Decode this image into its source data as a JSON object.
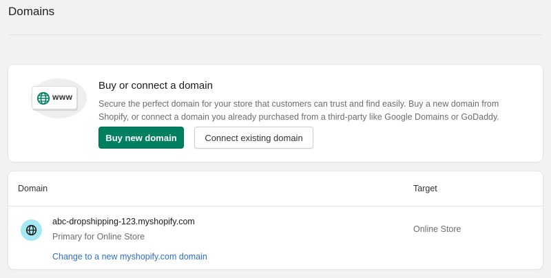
{
  "page": {
    "title": "Domains"
  },
  "buy_card": {
    "illustration_text": "www",
    "title": "Buy or connect a domain",
    "description": "Secure the perfect domain for your store that customers can trust and find easily. Buy a new domain from Shopify, or connect a domain you already purchased from a third-party like Google Domains or GoDaddy.",
    "buy_button": "Buy new domain",
    "connect_button": "Connect existing domain"
  },
  "domains_table": {
    "headers": {
      "domain": "Domain",
      "target": "Target"
    },
    "rows": [
      {
        "icon": "globe-icon",
        "domain": "abc-dropshipping-123.myshopify.com",
        "subtitle": "Primary for Online Store",
        "link": "Change to a new myshopify.com domain",
        "target": "Online Store"
      }
    ]
  },
  "colors": {
    "primary": "#008060",
    "link": "#2c6ecb",
    "globe_bg": "#a4e8f2",
    "illustration_globe": "#008060"
  }
}
